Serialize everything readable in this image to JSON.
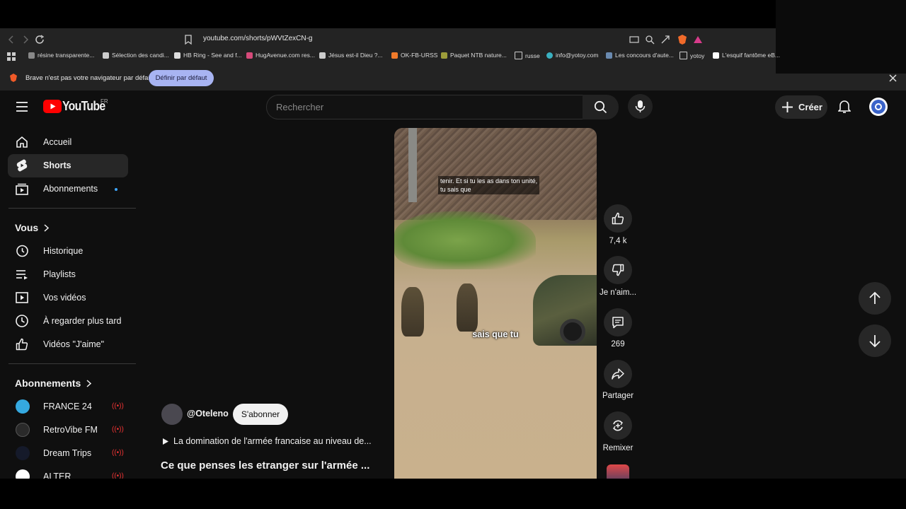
{
  "browser": {
    "url": "youtube.com/shorts/pWVtZexCN-g",
    "bookmarks": [
      "résine transparente...",
      "Sélection des candi...",
      "HB Ring - See and f...",
      "HugAvenue.com res...",
      "Jésus est-il Dieu ?...",
      "OK-FB-URSS",
      "Paquet NTB nature...",
      "russe",
      "info@yotoy.com",
      "Les concours d'aute...",
      "yotoy",
      "L'esquif fantôme eB..."
    ],
    "infobar": {
      "message": "Brave n'est pas votre navigateur par défaut",
      "button": "Définir par défaut"
    }
  },
  "header": {
    "logo": "YouTube",
    "region": "FR",
    "search_placeholder": "Rechercher",
    "create": "Créer"
  },
  "sidebar": {
    "main": [
      {
        "label": "Accueil",
        "icon": "home-icon"
      },
      {
        "label": "Shorts",
        "icon": "shorts-icon"
      },
      {
        "label": "Abonnements",
        "icon": "subscriptions-icon"
      }
    ],
    "you_heading": "Vous",
    "you": [
      {
        "label": "Historique",
        "icon": "history-icon"
      },
      {
        "label": "Playlists",
        "icon": "playlists-icon"
      },
      {
        "label": "Vos vidéos",
        "icon": "your-videos-icon"
      },
      {
        "label": "À regarder plus tard",
        "icon": "watch-later-icon"
      },
      {
        "label": "Vidéos \"J'aime\"",
        "icon": "liked-videos-icon"
      }
    ],
    "subs_heading": "Abonnements",
    "subscriptions": [
      "FRANCE 24",
      "RetroVibe FM",
      "Dream Trips",
      "ALTER"
    ]
  },
  "short": {
    "caption_top_line1": "tenir. Et si tu les as dans ton unité,",
    "caption_top_line2": "tu sais que",
    "caption_center": "sais que tu",
    "channel": "@Oteleno",
    "subscribe": "S'abonner",
    "description": "La domination de l'armée francaise au niveau de...",
    "title": "Ce que penses les etranger sur l'armée ..."
  },
  "actions": {
    "likes": "7,4 k",
    "dislike": "Je n'aim...",
    "comments": "269",
    "share": "Partager",
    "remix": "Remixer"
  },
  "colors": {
    "youtube_red": "#ff0000",
    "background": "#0f0f0f",
    "accent_button": "#a8b4f2"
  }
}
